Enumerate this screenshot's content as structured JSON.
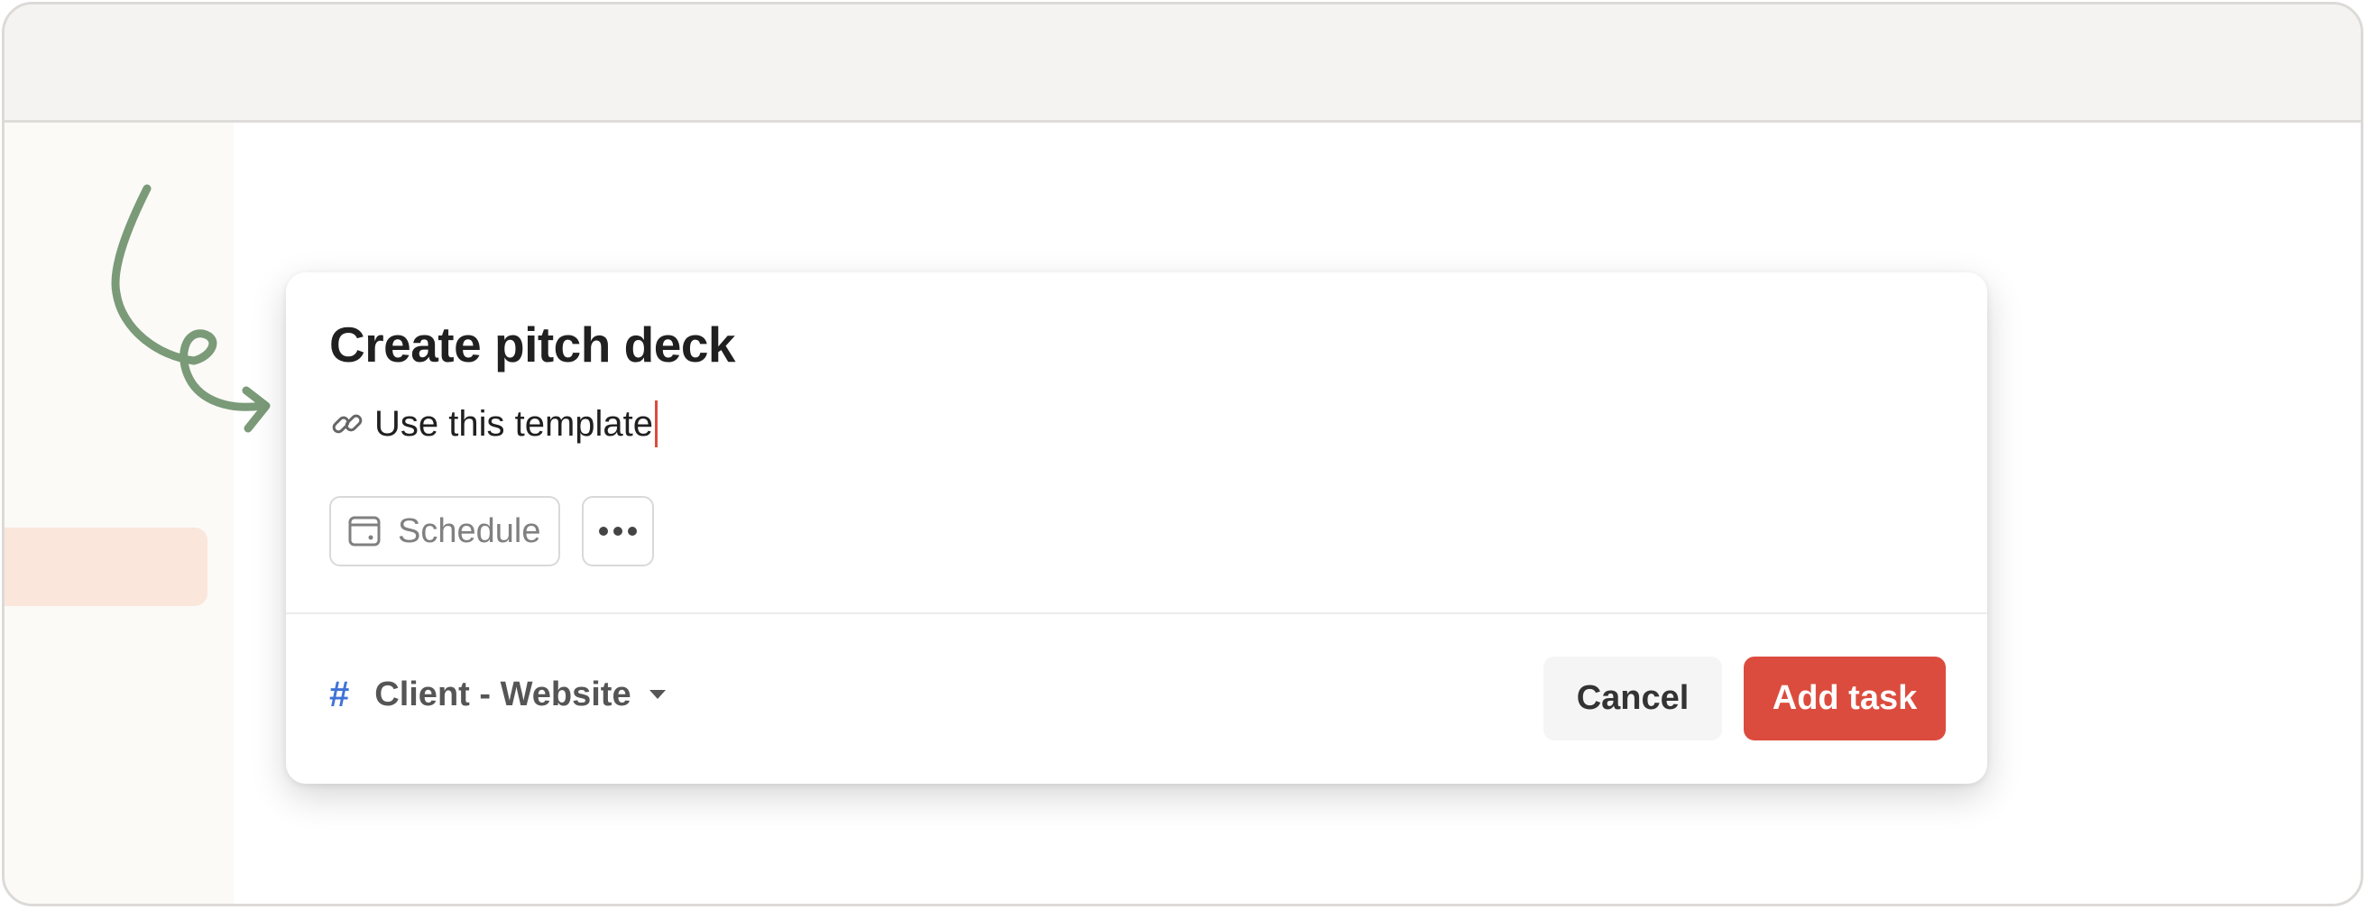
{
  "task": {
    "title": "Create pitch deck",
    "description": "Use this template"
  },
  "chips": {
    "schedule_label": "Schedule"
  },
  "project": {
    "name": "Client - Website"
  },
  "buttons": {
    "cancel": "Cancel",
    "add": "Add task"
  },
  "colors": {
    "accent": "#dc4c3e",
    "project_hash": "#4073d6",
    "arrow": "#7a9a78",
    "sidebar_highlight": "#fbe6dc"
  },
  "icons": [
    "link-icon",
    "calendar-icon",
    "more-icon",
    "hash-icon",
    "caret-down-icon"
  ]
}
